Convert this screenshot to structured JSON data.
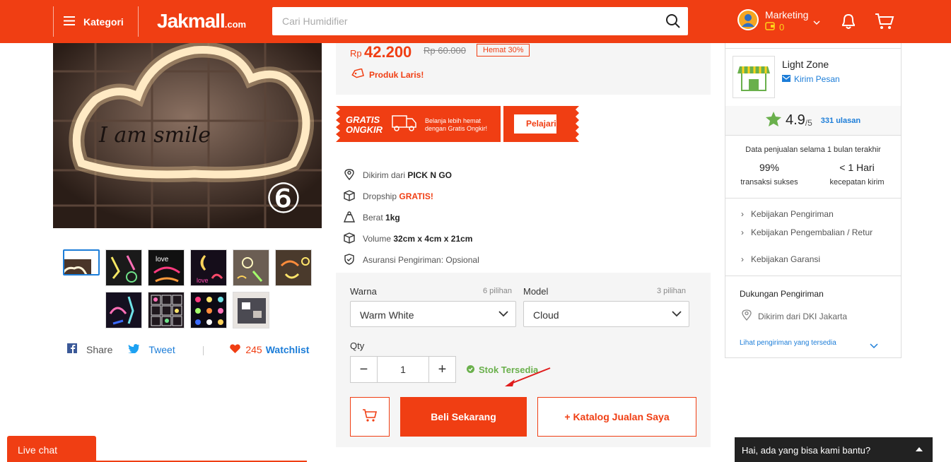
{
  "header": {
    "menu_label": "Kategori",
    "logo_main": "Jakmall",
    "logo_suffix": ".com",
    "search_placeholder": "Cari Humidifier",
    "user_name": "Marketing",
    "coins": "0"
  },
  "gallery": {
    "main_badge": "⑥",
    "main_text": "I am smile",
    "thumbnails": 10,
    "selected_index": 0
  },
  "social": {
    "share": "Share",
    "tweet": "Tweet",
    "separator": "|",
    "watch_count": "245",
    "watchlist": "Watchlist"
  },
  "product": {
    "currency": "Rp",
    "price": "42.200",
    "old_price": "Rp 60.000",
    "discount": "Hemat 30%",
    "bestseller": "Produk Laris!",
    "banner": {
      "line1": "GRATIS",
      "line2": "ONGKIR",
      "desc1": "Belanja lebih hemat",
      "desc2": "dengan Gratis Ongkir!",
      "button": "Pelajari"
    },
    "details": [
      {
        "label": "Dikirim dari",
        "value": "PICK N GO",
        "icon": "location-pin-icon"
      },
      {
        "label": "Dropship",
        "value": "GRATIS!",
        "icon": "box-icon"
      },
      {
        "label": "Berat",
        "value": "1kg",
        "icon": "weight-icon"
      },
      {
        "label": "Volume",
        "value": "32cm x 4cm x 21cm",
        "icon": "cube-icon"
      },
      {
        "label": "Asuransi Pengiriman: Opsional",
        "value": "",
        "icon": "shield-check-icon"
      }
    ]
  },
  "buy": {
    "variant1_label": "Warna",
    "variant1_count": "6 pilihan",
    "variant1_value": "Warm White",
    "variant2_label": "Model",
    "variant2_count": "3 pilihan",
    "variant2_value": "Cloud",
    "qty_label": "Qty",
    "qty_value": "1",
    "stock": "Stok Tersedia",
    "buy_now": "Beli Sekarang",
    "catalog": "+ Katalog Jualan Saya"
  },
  "seller": {
    "name": "Light Zone",
    "message": "Kirim Pesan",
    "rating": "4.9",
    "rating_max": "/5",
    "reviews": "331 ulasan",
    "stats_title": "Data penjualan selama 1 bulan terakhir",
    "success_value": "99%",
    "success_label": "transaksi sukses",
    "speed_value": "< 1 Hari",
    "speed_label": "kecepatan kirim",
    "policies": [
      "Kebijakan Pengiriman",
      "Kebijakan Pengembalian / Retur",
      "Kebijakan Garansi"
    ],
    "shipping_title": "Dukungan Pengiriman",
    "shipping_from": "Dikirim dari DKI Jakarta",
    "shipping_link": "Lihat pengiriman yang tersedia"
  },
  "chat": {
    "live": "Live chat",
    "help": "Hai, ada yang bisa kami bantu?"
  },
  "colors": {
    "brand": "#f03e13",
    "link": "#1c7dd8",
    "success": "#6ab04c"
  }
}
